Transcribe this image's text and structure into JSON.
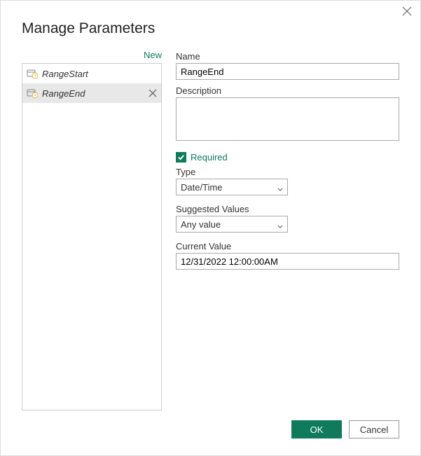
{
  "dialog": {
    "title": "Manage Parameters"
  },
  "sidebar": {
    "new_label": "New",
    "items": [
      {
        "label": "RangeStart",
        "selected": false
      },
      {
        "label": "RangeEnd",
        "selected": true
      }
    ]
  },
  "form": {
    "name_label": "Name",
    "name_value": "RangeEnd",
    "description_label": "Description",
    "description_value": "",
    "required_label": "Required",
    "required_checked": true,
    "type_label": "Type",
    "type_value": "Date/Time",
    "suggested_label": "Suggested Values",
    "suggested_value": "Any value",
    "current_label": "Current Value",
    "current_value": "12/31/2022 12:00:00AM"
  },
  "footer": {
    "ok_label": "OK",
    "cancel_label": "Cancel"
  },
  "colors": {
    "accent": "#0f7b5c"
  }
}
